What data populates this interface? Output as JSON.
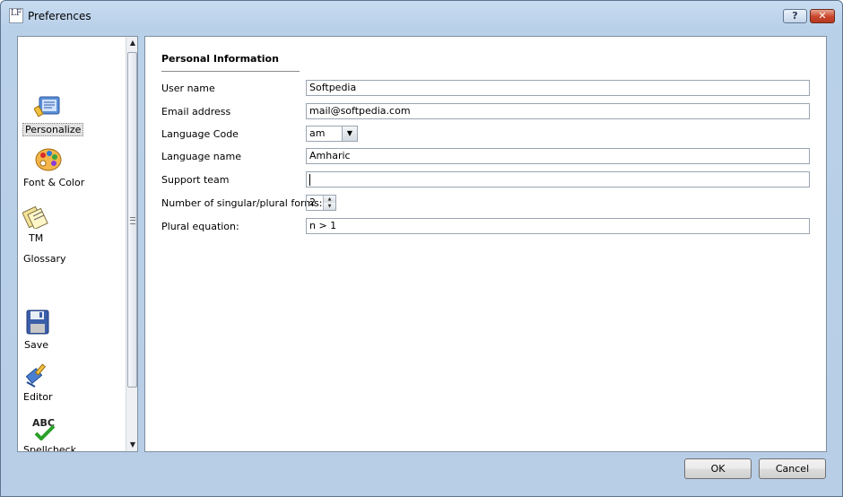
{
  "window": {
    "title": "Preferences",
    "app_icon_text": "LF",
    "help_glyph": "?",
    "close_glyph": "✕"
  },
  "sidebar": {
    "items": [
      {
        "label": "Personalize",
        "icon": "personalize-icon",
        "selected": true
      },
      {
        "label": "Font & Color",
        "icon": "palette-icon",
        "selected": false
      },
      {
        "label": "TM",
        "icon": "tm-icon",
        "selected": false
      },
      {
        "label": "Glossary",
        "icon": "glossary-icon",
        "selected": false
      },
      {
        "label": "Save",
        "icon": "floppy-disk-icon",
        "selected": false
      },
      {
        "label": "Editor",
        "icon": "brush-icon",
        "selected": false
      },
      {
        "label": "Spellcheck",
        "icon": "abc-check-icon",
        "selected": false
      }
    ],
    "scroll_up": "▲",
    "scroll_down": "▼"
  },
  "main": {
    "section_title": "Personal Information",
    "fields": {
      "user_name": {
        "label": "User name",
        "value": "Softpedia"
      },
      "email": {
        "label": "Email address",
        "value": "mail@softpedia.com"
      },
      "language_code": {
        "label": "Language Code",
        "value": "am",
        "arrow": "▼"
      },
      "language_name": {
        "label": "Language name",
        "value": "Amharic"
      },
      "support_team": {
        "label": "Support team",
        "value": ""
      },
      "plural_forms": {
        "label": "Number of singular/plural forms:",
        "value": "2",
        "up": "▲",
        "down": "▼"
      },
      "plural_equation": {
        "label": "Plural equation:",
        "value": "n > 1"
      }
    }
  },
  "footer": {
    "ok_label": "OK",
    "cancel_label": "Cancel"
  }
}
